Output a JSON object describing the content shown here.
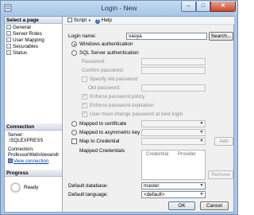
{
  "window": {
    "title": "Login - New"
  },
  "left_panel": {
    "select_page_header": "Select a page",
    "pages": [
      "General",
      "Server Roles",
      "User Mapping",
      "Securables",
      "Status"
    ],
    "connection_header": "Connection",
    "server_label": "Server:",
    "server_value": ".\\SQLEXPRESS",
    "connection_label": "Connection:",
    "connection_value": "ProfessorWeb\\Alexandr",
    "view_connection": "View connection",
    "progress_header": "Progress",
    "progress_status": "Ready"
  },
  "toolbar": {
    "script_label": "Script",
    "help_label": "Help"
  },
  "form": {
    "login_name_label": "Login name:",
    "login_name_value": "vasya",
    "search_button": "Search...",
    "windows_auth_label": "Windows authentication",
    "sql_auth_label": "SQL Server authentication",
    "password_label": "Password:",
    "confirm_password_label": "Confirm password:",
    "specify_old_password_label": "Specify old password",
    "old_password_label": "Old password:",
    "enforce_policy_label": "Enforce password policy",
    "enforce_expiration_label": "Enforce password expiration",
    "must_change_label": "User must change password at next login",
    "mapped_certificate_label": "Mapped to certificate",
    "mapped_asym_key_label": "Mapped to asymmetric key",
    "map_credential_label": "Map to Credential",
    "add_button": "Add",
    "mapped_credentials_label": "Mapped Credentials",
    "credential_col": "Credential",
    "provider_col": "Provider",
    "remove_button": "Remove",
    "default_database_label": "Default database:",
    "default_database_value": "master",
    "default_language_label": "Default language:",
    "default_language_value": "<default>"
  },
  "footer": {
    "ok_button": "OK",
    "cancel_button": "Cancel"
  }
}
